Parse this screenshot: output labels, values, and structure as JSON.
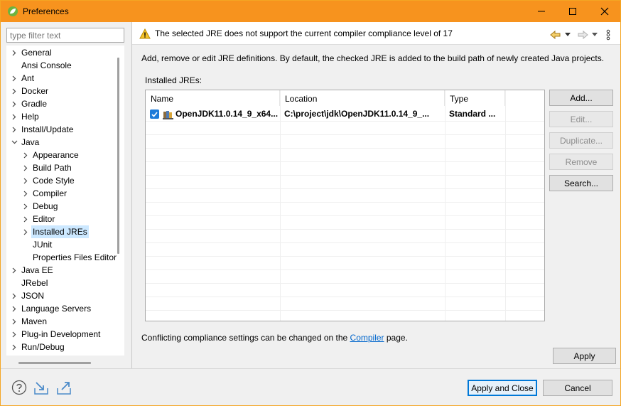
{
  "window": {
    "title": "Preferences"
  },
  "filter": {
    "placeholder": "type filter text",
    "value": ""
  },
  "tree": [
    {
      "label": "General",
      "expandable": true,
      "expanded": false,
      "level": 0
    },
    {
      "label": "Ansi Console",
      "expandable": false,
      "level": 0
    },
    {
      "label": "Ant",
      "expandable": true,
      "expanded": false,
      "level": 0
    },
    {
      "label": "Docker",
      "expandable": true,
      "expanded": false,
      "level": 0
    },
    {
      "label": "Gradle",
      "expandable": true,
      "expanded": false,
      "level": 0
    },
    {
      "label": "Help",
      "expandable": true,
      "expanded": false,
      "level": 0
    },
    {
      "label": "Install/Update",
      "expandable": true,
      "expanded": false,
      "level": 0
    },
    {
      "label": "Java",
      "expandable": true,
      "expanded": true,
      "level": 0
    },
    {
      "label": "Appearance",
      "expandable": true,
      "expanded": false,
      "level": 1
    },
    {
      "label": "Build Path",
      "expandable": true,
      "expanded": false,
      "level": 1
    },
    {
      "label": "Code Style",
      "expandable": true,
      "expanded": false,
      "level": 1
    },
    {
      "label": "Compiler",
      "expandable": true,
      "expanded": false,
      "level": 1
    },
    {
      "label": "Debug",
      "expandable": true,
      "expanded": false,
      "level": 1
    },
    {
      "label": "Editor",
      "expandable": true,
      "expanded": false,
      "level": 1
    },
    {
      "label": "Installed JREs",
      "expandable": true,
      "expanded": false,
      "level": 1,
      "selected": true
    },
    {
      "label": "JUnit",
      "expandable": false,
      "level": 1
    },
    {
      "label": "Properties Files Editor",
      "expandable": false,
      "level": 1
    },
    {
      "label": "Java EE",
      "expandable": true,
      "expanded": false,
      "level": 0
    },
    {
      "label": "JRebel",
      "expandable": false,
      "level": 0
    },
    {
      "label": "JSON",
      "expandable": true,
      "expanded": false,
      "level": 0
    },
    {
      "label": "Language Servers",
      "expandable": true,
      "expanded": false,
      "level": 0
    },
    {
      "label": "Maven",
      "expandable": true,
      "expanded": false,
      "level": 0
    },
    {
      "label": "Plug-in Development",
      "expandable": true,
      "expanded": false,
      "level": 0
    },
    {
      "label": "Run/Debug",
      "expandable": true,
      "expanded": false,
      "level": 0
    }
  ],
  "page": {
    "warning": "The selected JRE does not support the current compiler compliance level of 17",
    "description": "Add, remove or edit JRE definitions. By default, the checked JRE is added to the build path of newly created Java projects.",
    "installed_label": "Installed JREs:",
    "columns": [
      "Name",
      "Location",
      "Type"
    ],
    "rows": [
      {
        "checked": true,
        "name": "OpenJDK11.0.14_9_x64...",
        "location": "C:\\project\\jdk\\OpenJDK11.0.14_9_...",
        "type": "Standard ..."
      }
    ],
    "buttons": {
      "add": "Add...",
      "edit": "Edit...",
      "duplicate": "Duplicate...",
      "remove": "Remove",
      "search": "Search..."
    },
    "conflict_prefix": "Conflicting compliance settings can be changed on the ",
    "conflict_link": "Compiler",
    "conflict_suffix": " page.",
    "apply": "Apply"
  },
  "footer": {
    "apply_close": "Apply and Close",
    "cancel": "Cancel"
  },
  "colors": {
    "titlebar": "#f7931e",
    "selection": "#cce8ff",
    "link": "#0066cc",
    "checkbox": "#1e7bd9"
  }
}
